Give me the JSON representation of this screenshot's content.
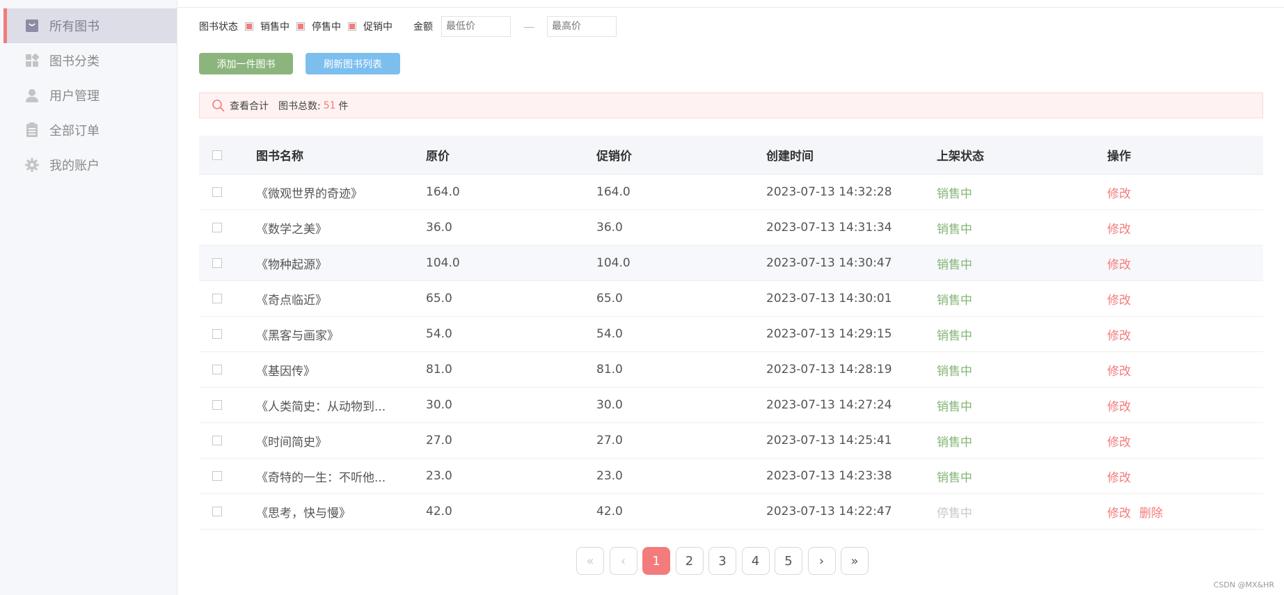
{
  "sidebar": {
    "items": [
      {
        "label": "所有图书",
        "icon": "bag-icon",
        "active": true
      },
      {
        "label": "图书分类",
        "icon": "category-grid-icon",
        "active": false
      },
      {
        "label": "用户管理",
        "icon": "user-icon",
        "active": false
      },
      {
        "label": "全部订单",
        "icon": "clipboard-icon",
        "active": false
      },
      {
        "label": "我的账户",
        "icon": "gear-icon",
        "active": false
      }
    ]
  },
  "filter": {
    "status_label": "图书状态",
    "options": [
      "销售中",
      "停售中",
      "促销中"
    ],
    "money_label": "金额",
    "min_placeholder": "最低价",
    "max_placeholder": "最高价",
    "separator": "—"
  },
  "toolbar": {
    "add_label": "添加一件图书",
    "refresh_label": "刷新图书列表"
  },
  "summary": {
    "view_total_label": "查看合计",
    "total_label": "图书总数:",
    "total_count": "51",
    "unit": "件"
  },
  "table": {
    "headers": [
      "图书名称",
      "原价",
      "促销价",
      "创建时间",
      "上架状态",
      "操作"
    ],
    "rows": [
      {
        "name": "《微观世界的奇迹》",
        "orig": "164.0",
        "promo": "164.0",
        "time": "2023-07-13 14:32:28",
        "status": "销售中",
        "ops": [
          "修改"
        ]
      },
      {
        "name": "《数学之美》",
        "orig": "36.0",
        "promo": "36.0",
        "time": "2023-07-13 14:31:34",
        "status": "销售中",
        "ops": [
          "修改"
        ]
      },
      {
        "name": "《物种起源》",
        "orig": "104.0",
        "promo": "104.0",
        "time": "2023-07-13 14:30:47",
        "status": "销售中",
        "ops": [
          "修改"
        ]
      },
      {
        "name": "《奇点临近》",
        "orig": "65.0",
        "promo": "65.0",
        "time": "2023-07-13 14:30:01",
        "status": "销售中",
        "ops": [
          "修改"
        ]
      },
      {
        "name": "《黑客与画家》",
        "orig": "54.0",
        "promo": "54.0",
        "time": "2023-07-13 14:29:15",
        "status": "销售中",
        "ops": [
          "修改"
        ]
      },
      {
        "name": "《基因传》",
        "orig": "81.0",
        "promo": "81.0",
        "time": "2023-07-13 14:28:19",
        "status": "销售中",
        "ops": [
          "修改"
        ]
      },
      {
        "name": "《人类简史：从动物到...",
        "orig": "30.0",
        "promo": "30.0",
        "time": "2023-07-13 14:27:24",
        "status": "销售中",
        "ops": [
          "修改"
        ]
      },
      {
        "name": "《时间简史》",
        "orig": "27.0",
        "promo": "27.0",
        "time": "2023-07-13 14:25:41",
        "status": "销售中",
        "ops": [
          "修改"
        ]
      },
      {
        "name": "《奇特的一生：不听他...",
        "orig": "23.0",
        "promo": "23.0",
        "time": "2023-07-13 14:23:38",
        "status": "销售中",
        "ops": [
          "修改"
        ]
      },
      {
        "name": "《思考，快与慢》",
        "orig": "42.0",
        "promo": "42.0",
        "time": "2023-07-13 14:22:47",
        "status": "停售中",
        "ops": [
          "修改",
          "删除"
        ]
      }
    ]
  },
  "pagination": {
    "first": "«",
    "prev": "‹",
    "pages": [
      "1",
      "2",
      "3",
      "4",
      "5"
    ],
    "current": "1",
    "next": "›",
    "last": "»"
  },
  "colors": {
    "accent": "#f47b7b",
    "on_sale": "#83b575",
    "off_sale": "#c8c8c8",
    "add_button": "#8cb57e",
    "refresh_button": "#7cbfef"
  },
  "watermark": "CSDN @MX&HR"
}
